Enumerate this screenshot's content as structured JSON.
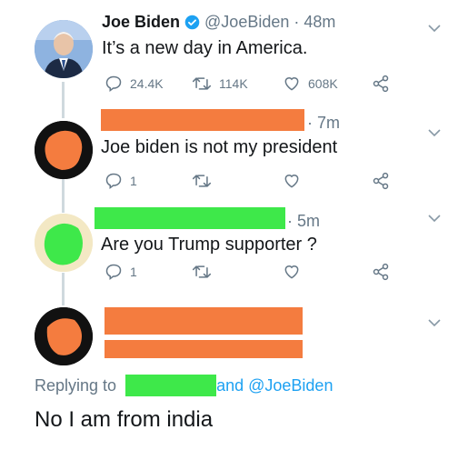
{
  "colors": {
    "accent": "#1da1f2",
    "muted": "#657786",
    "redact_orange": "#f47c3f",
    "redact_green": "#3ee84a",
    "verified": "#1da1f2"
  },
  "tweets": [
    {
      "name": "Joe Biden",
      "handle": "@JoeBiden",
      "time": "· 48m",
      "text": "It’s a new day in America.",
      "verified": true,
      "reply_count": "24.4K",
      "retweet_count": "114K",
      "like_count": "608K"
    },
    {
      "time": "· 7m",
      "text": "Joe biden is not my president",
      "reply_count": "1",
      "retweet_count": "",
      "like_count": ""
    },
    {
      "time": "· 5m",
      "text": "Are you Trump supporter ?",
      "reply_count": "1",
      "retweet_count": "",
      "like_count": ""
    }
  ],
  "reply": {
    "replying_to": "Replying to",
    "and_mention": "and @JoeBiden",
    "text": "No I am from india"
  },
  "icons": [
    "reply-icon",
    "retweet-icon",
    "like-icon",
    "share-icon",
    "chevron-down-icon",
    "verified-badge-icon"
  ]
}
